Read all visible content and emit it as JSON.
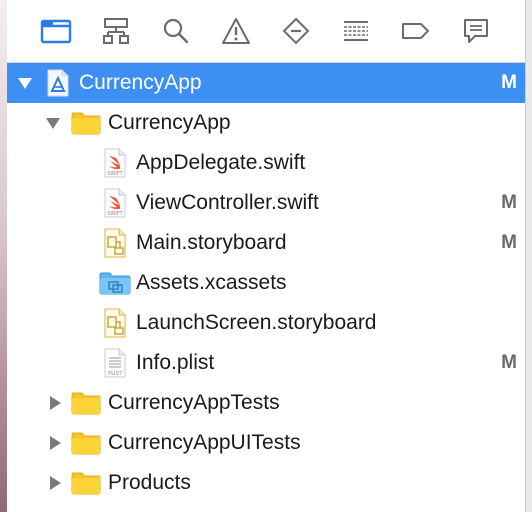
{
  "toolbar": {
    "tabs": [
      {
        "icon": "folder-icon",
        "active": true
      },
      {
        "icon": "hierarchy-icon",
        "active": false
      },
      {
        "icon": "search-icon",
        "active": false
      },
      {
        "icon": "warning-icon",
        "active": false
      },
      {
        "icon": "test-diamond-icon",
        "active": false
      },
      {
        "icon": "debug-list-icon",
        "active": false
      },
      {
        "icon": "breakpoint-tag-icon",
        "active": false
      },
      {
        "icon": "report-bubble-icon",
        "active": false
      }
    ],
    "active_color": "#2f7de1",
    "inactive_color": "#6b6b6b"
  },
  "tree": {
    "selection_color": "#3d8ff4",
    "items": [
      {
        "label": "CurrencyApp",
        "status": "M",
        "kind": "project",
        "expanded": true,
        "selected": true
      },
      {
        "label": "CurrencyApp",
        "status": "",
        "kind": "group",
        "expanded": true
      },
      {
        "label": "AppDelegate.swift",
        "status": "",
        "kind": "swift"
      },
      {
        "label": "ViewController.swift",
        "status": "M",
        "kind": "swift"
      },
      {
        "label": "Main.storyboard",
        "status": "M",
        "kind": "storyboard"
      },
      {
        "label": "Assets.xcassets",
        "status": "",
        "kind": "assets"
      },
      {
        "label": "LaunchScreen.storyboard",
        "status": "",
        "kind": "storyboard"
      },
      {
        "label": "Info.plist",
        "status": "M",
        "kind": "plist"
      },
      {
        "label": "CurrencyAppTests",
        "status": "",
        "kind": "group",
        "expanded": false
      },
      {
        "label": "CurrencyAppUITests",
        "status": "",
        "kind": "group",
        "expanded": false
      },
      {
        "label": "Products",
        "status": "",
        "kind": "group",
        "expanded": false
      }
    ]
  }
}
